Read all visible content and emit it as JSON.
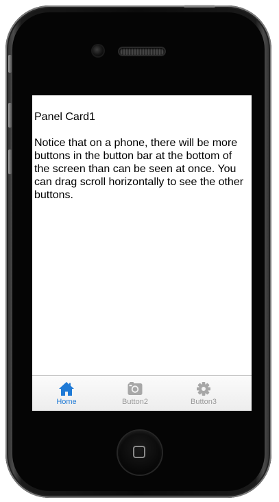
{
  "panel": {
    "title": "Panel Card1",
    "body": "Notice that on a phone, there will be more buttons in the button bar at the bottom of the screen than can be seen at once. You can drag scroll horizontally to see the other buttons."
  },
  "tabbar": {
    "tabs": [
      {
        "label": "Home",
        "icon": "home-icon",
        "active": true
      },
      {
        "label": "Button2",
        "icon": "camera-icon",
        "active": false
      },
      {
        "label": "Button3",
        "icon": "gear-icon",
        "active": false
      }
    ]
  },
  "colors": {
    "active_tab": "#1f7ad6",
    "inactive_tab": "#9a9a9a",
    "screen_background": "#ffffff",
    "phone_body": "#0c0c0c"
  }
}
